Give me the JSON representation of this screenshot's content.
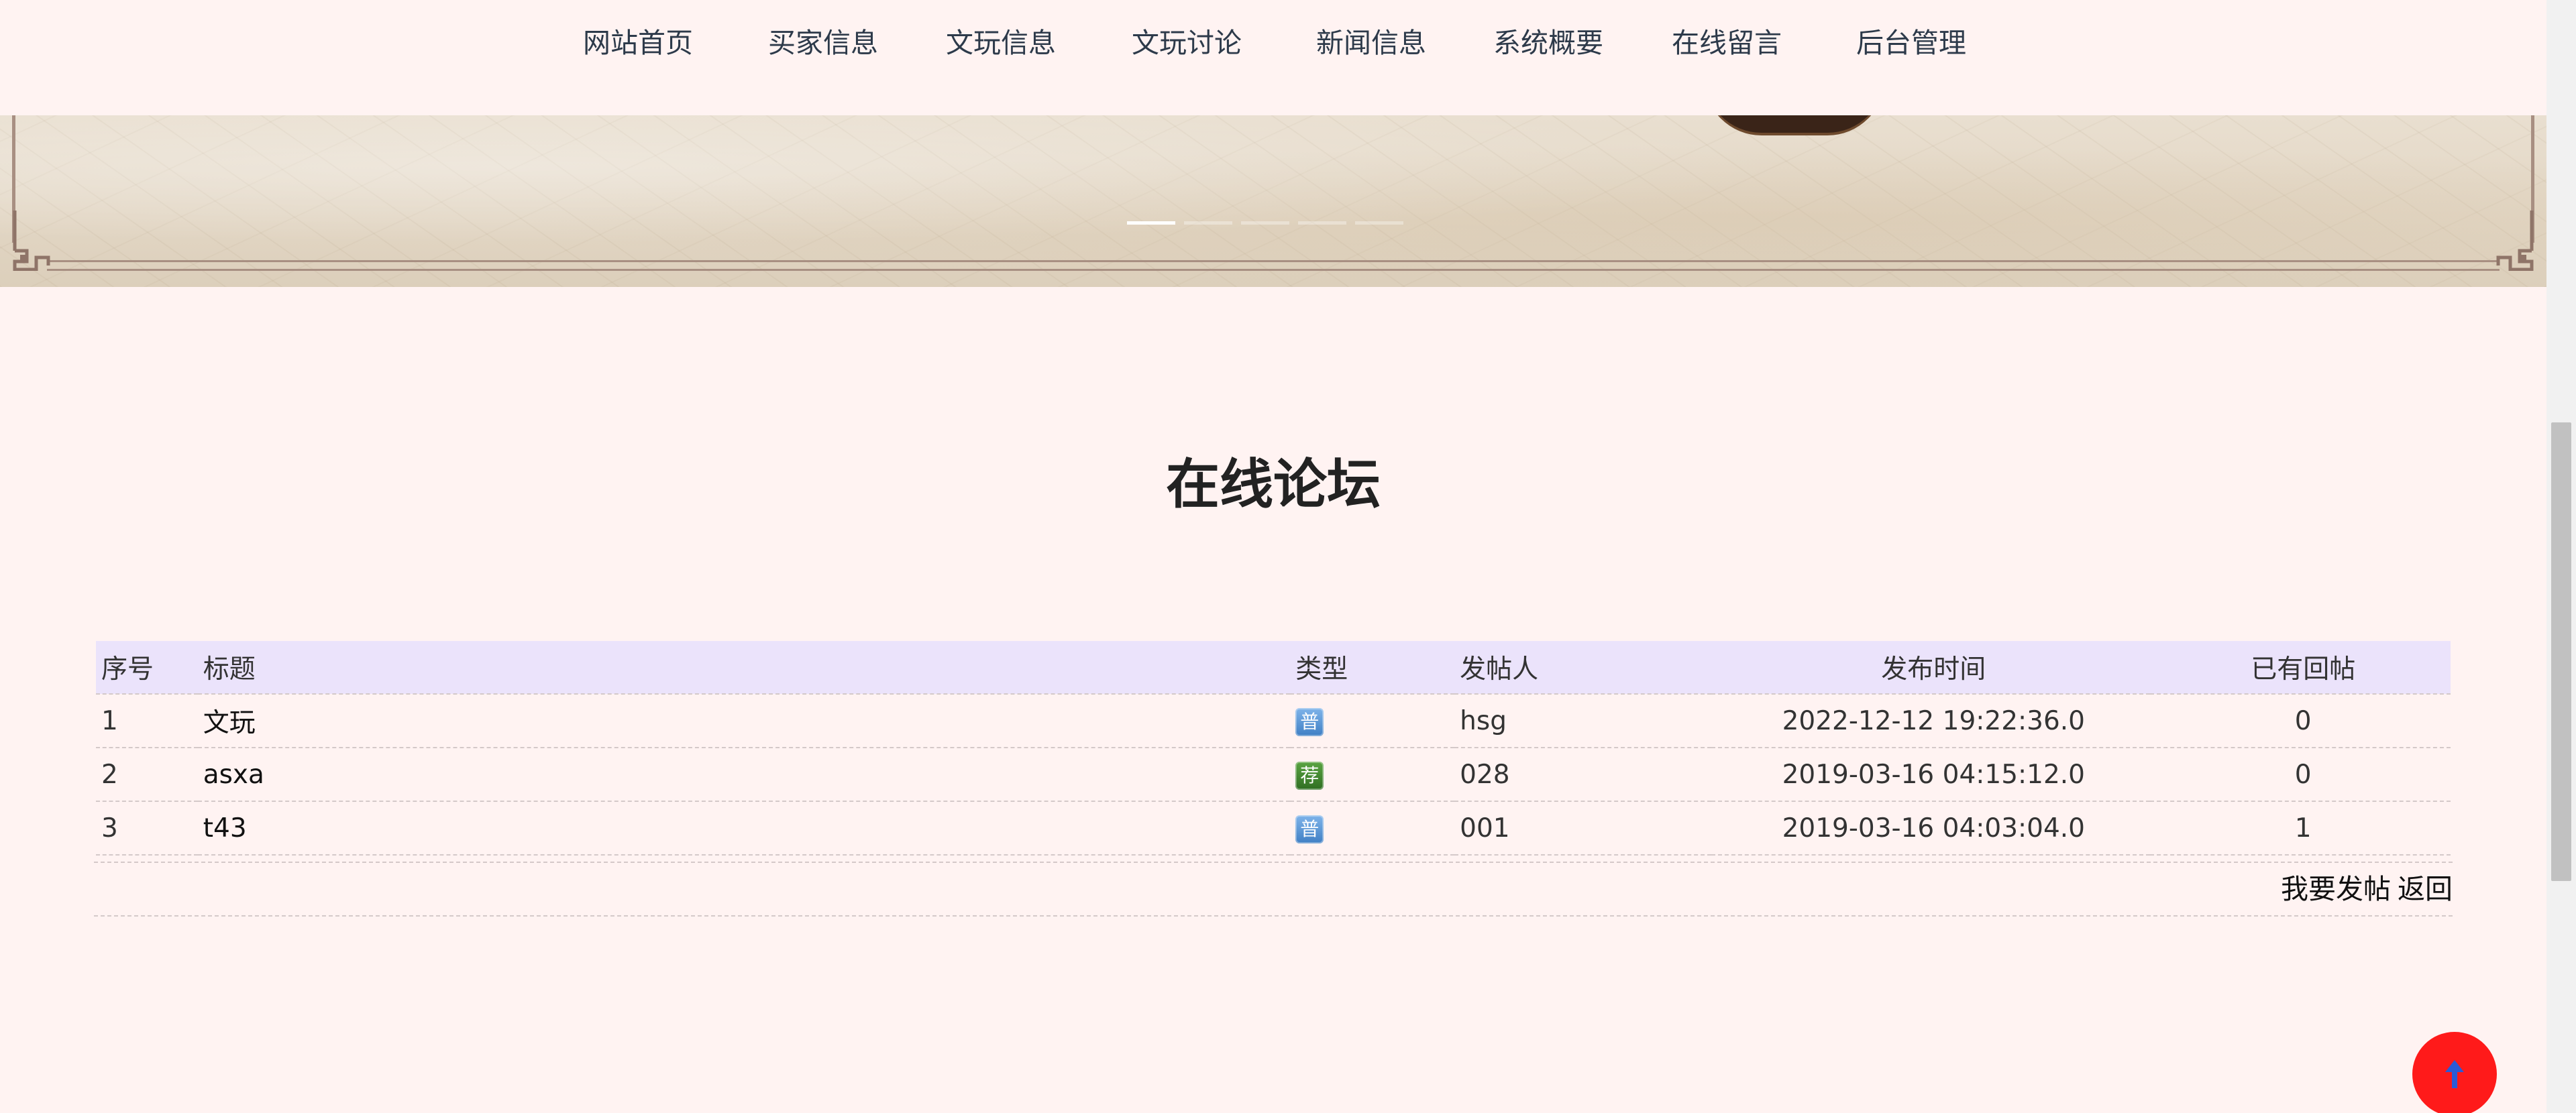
{
  "nav": {
    "items": [
      {
        "label": "网站首页"
      },
      {
        "label": "买家信息"
      },
      {
        "label": "文玩信息"
      },
      {
        "label": "文玩讨论"
      },
      {
        "label": "新闻信息"
      },
      {
        "label": "系统概要"
      },
      {
        "label": "在线留言"
      },
      {
        "label": "后台管理"
      }
    ]
  },
  "banner": {
    "slide_count": 5,
    "active_slide": 1
  },
  "forum": {
    "title": "在线论坛",
    "columns": {
      "no": "序号",
      "title": "标题",
      "type": "类型",
      "author": "发帖人",
      "time": "发布时间",
      "replies": "已有回帖"
    },
    "rows": [
      {
        "no": "1",
        "title": "文玩",
        "type_badge": "普",
        "type_color": "#3f7fc4",
        "type_icon": "normal-post-icon",
        "author": "hsg",
        "time": "2022-12-12 19:22:36.0",
        "replies": "0"
      },
      {
        "no": "2",
        "title": "asxa",
        "type_badge": "荐",
        "type_color": "#2f6e22",
        "type_icon": "recommended-post-icon",
        "author": "028",
        "time": "2019-03-16 04:15:12.0",
        "replies": "0"
      },
      {
        "no": "3",
        "title": "t43",
        "type_badge": "普",
        "type_color": "#3f7fc4",
        "type_icon": "normal-post-icon",
        "author": "001",
        "time": "2019-03-16 04:03:04.0",
        "replies": "1"
      }
    ],
    "actions": {
      "new_post": "我要发帖",
      "back": "返回"
    }
  },
  "back_to_top": {
    "icon": "arrow-up-icon",
    "color": "#ff1a1a"
  },
  "colors": {
    "page_bg": "#fff3f2",
    "table_header_bg": "#ebe3fb",
    "nav_text": "#2d3a4a"
  }
}
